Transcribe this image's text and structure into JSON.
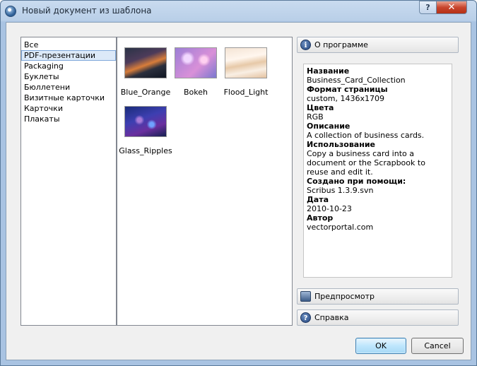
{
  "window": {
    "title": "Новый документ из шаблона",
    "help_button": "?",
    "close_button": "✕"
  },
  "categories": [
    "Все",
    "PDF-презентации",
    "Packaging",
    "Буклеты",
    "Бюллетени",
    "Визитные карточки",
    "Карточки",
    "Плакаты"
  ],
  "selected_category": "PDF-презентации",
  "templates": [
    "Blue_Orange",
    "Bokeh",
    "Flood_Light",
    "Glass_Ripples"
  ],
  "about_button": "О программе",
  "info": [
    {
      "label": "Название",
      "value": "Business_Card_Collection"
    },
    {
      "label": "Формат страницы",
      "value": "custom, 1436x1709"
    },
    {
      "label": "Цвета",
      "value": "RGB"
    },
    {
      "label": "Описание",
      "value": "A collection of business cards."
    },
    {
      "label": "Использование",
      "value": "Copy a business card into a document or the Scrapbook to reuse and edit it."
    },
    {
      "label": "Создано при помощи:",
      "value": "Scribus 1.3.9.svn"
    },
    {
      "label": "Дата",
      "value": "2010-10-23"
    },
    {
      "label": "Автор",
      "value": "vectorportal.com"
    }
  ],
  "preview_button": "Предпросмотр",
  "help_button": "Справка",
  "ok_button": "OK",
  "cancel_button": "Cancel"
}
